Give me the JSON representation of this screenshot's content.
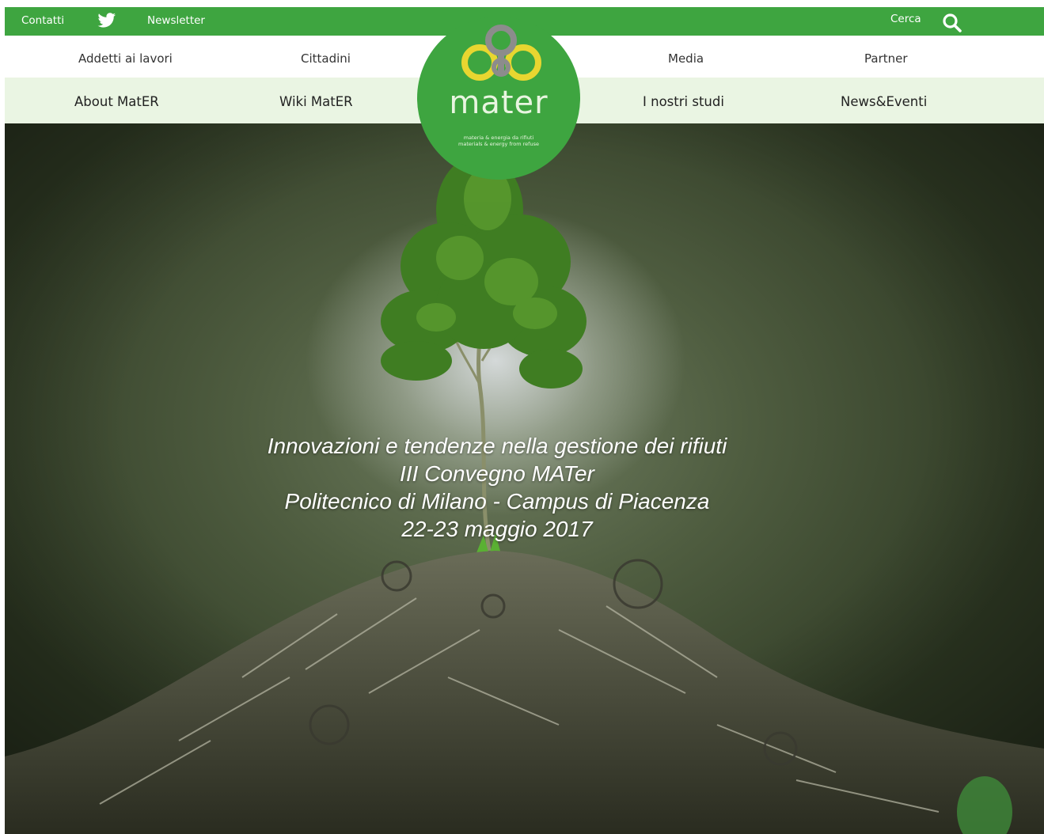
{
  "topbar": {
    "contatti": "Contatti",
    "twitter_icon": "twitter-icon",
    "newsletter": "Newsletter",
    "cerca": "Cerca",
    "search_icon": "search-icon"
  },
  "nav_primary": {
    "items": [
      {
        "label": "Addetti ai lavori"
      },
      {
        "label": "Cittadini"
      },
      {
        "label": "Media"
      },
      {
        "label": "Partner"
      }
    ]
  },
  "nav_secondary": {
    "items": [
      {
        "label": "About MatER"
      },
      {
        "label": "Wiki MatER"
      },
      {
        "label": "I nostri studi"
      },
      {
        "label": "News&Eventi"
      }
    ]
  },
  "logo": {
    "word": "mater",
    "tagline_1": "materia & energia da rifiuti",
    "tagline_2": "materials & energy from refuse"
  },
  "hero": {
    "lines": [
      "Innovazioni e tendenze nella gestione dei rifiuti",
      "III Convegno MATer",
      "Politecnico di Milano - Campus di Piacenza",
      "22-23 maggio 2017"
    ]
  },
  "colors": {
    "brand_green": "#3ea540",
    "nav_secondary_bg": "#eaf5e3",
    "logo_yellow": "#e8d630",
    "logo_gray": "#8c8c8c"
  }
}
